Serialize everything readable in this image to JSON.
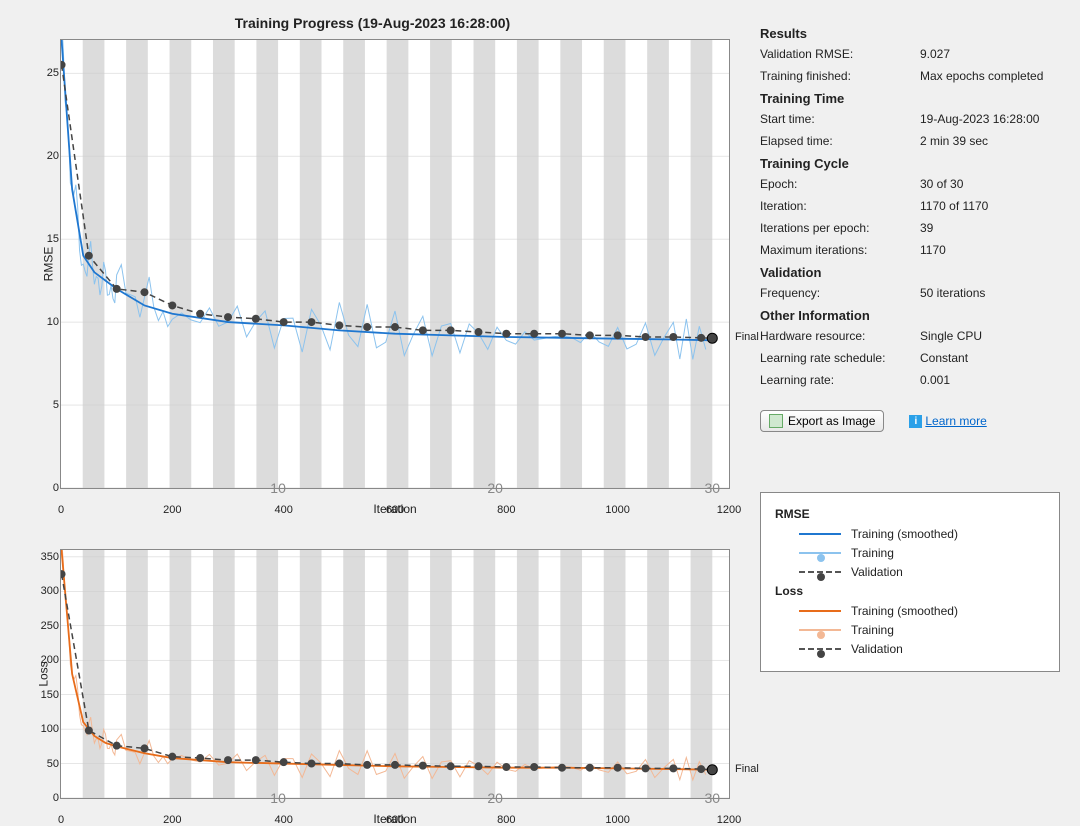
{
  "title": "Training Progress (19-Aug-2023 16:28:00)",
  "results": {
    "heading": "Results",
    "validation_rmse_label": "Validation RMSE:",
    "validation_rmse_value": "9.027",
    "training_finished_label": "Training finished:",
    "training_finished_value": "Max epochs completed"
  },
  "training_time": {
    "heading": "Training Time",
    "start_label": "Start time:",
    "start_value": "19-Aug-2023 16:28:00",
    "elapsed_label": "Elapsed time:",
    "elapsed_value": "2 min 39 sec"
  },
  "training_cycle": {
    "heading": "Training Cycle",
    "epoch_label": "Epoch:",
    "epoch_value": "30 of 30",
    "iteration_label": "Iteration:",
    "iteration_value": "1170 of 1170",
    "ipe_label": "Iterations per epoch:",
    "ipe_value": "39",
    "maxiter_label": "Maximum iterations:",
    "maxiter_value": "1170"
  },
  "validation": {
    "heading": "Validation",
    "freq_label": "Frequency:",
    "freq_value": "50 iterations"
  },
  "other": {
    "heading": "Other Information",
    "hw_label": "Hardware resource:",
    "hw_value": "Single CPU",
    "sched_label": "Learning rate schedule:",
    "sched_value": "Constant",
    "lr_label": "Learning rate:",
    "lr_value": "0.001"
  },
  "export_label": "Export as Image",
  "learn_label": "Learn more",
  "axes": {
    "rmse": {
      "ylabel": "RMSE",
      "xlabel": "Iteration"
    },
    "loss": {
      "ylabel": "Loss",
      "xlabel": "Iteration"
    },
    "epoch10": "10",
    "epoch20": "20",
    "epoch30": "30",
    "final": "Final"
  },
  "legend": {
    "rmse_heading": "RMSE",
    "loss_heading": "Loss",
    "train_smooth": "Training (smoothed)",
    "train": "Training",
    "valid": "Validation"
  },
  "chart_data": [
    {
      "type": "line",
      "title": "RMSE",
      "xlabel": "Iteration",
      "ylabel": "RMSE",
      "xlim": [
        0,
        1200
      ],
      "ylim": [
        0,
        27
      ],
      "x_ticks": [
        0,
        200,
        400,
        600,
        800,
        1000,
        1200
      ],
      "y_ticks": [
        0,
        5,
        10,
        15,
        20,
        25
      ],
      "epoch_markers": [
        {
          "x": 390,
          "label": "10"
        },
        {
          "x": 780,
          "label": "20"
        },
        {
          "x": 1170,
          "label": "30"
        }
      ],
      "series": [
        {
          "name": "Training (smoothed)",
          "color": "#1f77d0",
          "x": [
            1,
            20,
            40,
            60,
            80,
            100,
            150,
            200,
            300,
            400,
            500,
            600,
            700,
            800,
            900,
            1000,
            1100,
            1170
          ],
          "values": [
            27,
            18,
            14,
            13,
            12.5,
            12,
            11,
            10.5,
            10,
            9.8,
            9.5,
            9.3,
            9.2,
            9.1,
            9.05,
            9.0,
            8.95,
            8.9
          ]
        },
        {
          "name": "Training",
          "color": "#8cc3ee",
          "x": [
            1,
            20,
            40,
            60,
            80,
            100,
            150,
            200,
            300,
            400,
            500,
            600,
            700,
            800,
            900,
            1000,
            1100,
            1170
          ],
          "values": [
            27,
            18.5,
            13.5,
            13.2,
            12,
            12.3,
            11.3,
            10.3,
            10.2,
            9.6,
            9.7,
            9.2,
            9.3,
            9.0,
            9.1,
            8.9,
            9.0,
            8.8
          ]
        },
        {
          "name": "Validation",
          "color": "#444",
          "dashed": true,
          "x": [
            1,
            50,
            100,
            150,
            200,
            250,
            300,
            350,
            400,
            450,
            500,
            550,
            600,
            650,
            700,
            750,
            800,
            850,
            900,
            950,
            1000,
            1050,
            1100,
            1150,
            1170
          ],
          "values": [
            25.5,
            14,
            12,
            11.8,
            11,
            10.5,
            10.3,
            10.2,
            10,
            10,
            9.8,
            9.7,
            9.7,
            9.5,
            9.5,
            9.4,
            9.3,
            9.3,
            9.3,
            9.2,
            9.2,
            9.1,
            9.1,
            9.05,
            9.027
          ]
        }
      ],
      "final_label": "Final"
    },
    {
      "type": "line",
      "title": "Loss",
      "xlabel": "Iteration",
      "ylabel": "Loss",
      "xlim": [
        0,
        1200
      ],
      "ylim": [
        0,
        360
      ],
      "x_ticks": [
        0,
        200,
        400,
        600,
        800,
        1000,
        1200
      ],
      "y_ticks": [
        0,
        50,
        100,
        150,
        200,
        250,
        300,
        350
      ],
      "epoch_markers": [
        {
          "x": 390,
          "label": "10"
        },
        {
          "x": 780,
          "label": "20"
        },
        {
          "x": 1170,
          "label": "30"
        }
      ],
      "series": [
        {
          "name": "Training (smoothed)",
          "color": "#e86c1a",
          "x": [
            1,
            20,
            40,
            60,
            80,
            100,
            150,
            200,
            300,
            400,
            500,
            600,
            700,
            800,
            900,
            1000,
            1100,
            1170
          ],
          "values": [
            360,
            180,
            110,
            90,
            80,
            75,
            65,
            58,
            52,
            50,
            48,
            46,
            45,
            44,
            44,
            43,
            42,
            41
          ]
        },
        {
          "name": "Training",
          "color": "#f3b895",
          "x": [
            1,
            20,
            40,
            60,
            80,
            100,
            150,
            200,
            300,
            400,
            500,
            600,
            700,
            800,
            900,
            1000,
            1100,
            1170
          ],
          "values": [
            360,
            185,
            105,
            92,
            78,
            77,
            63,
            59,
            53,
            49,
            49,
            45,
            46,
            43,
            45,
            42,
            43,
            40
          ]
        },
        {
          "name": "Validation",
          "color": "#444",
          "dashed": true,
          "x": [
            1,
            50,
            100,
            150,
            200,
            250,
            300,
            350,
            400,
            450,
            500,
            550,
            600,
            650,
            700,
            750,
            800,
            850,
            900,
            950,
            1000,
            1050,
            1100,
            1150,
            1170
          ],
          "values": [
            325,
            98,
            76,
            72,
            60,
            58,
            55,
            55,
            52,
            50,
            50,
            48,
            48,
            47,
            46,
            46,
            45,
            45,
            44,
            44,
            44,
            43,
            43,
            42,
            41
          ]
        }
      ],
      "final_label": "Final"
    }
  ]
}
